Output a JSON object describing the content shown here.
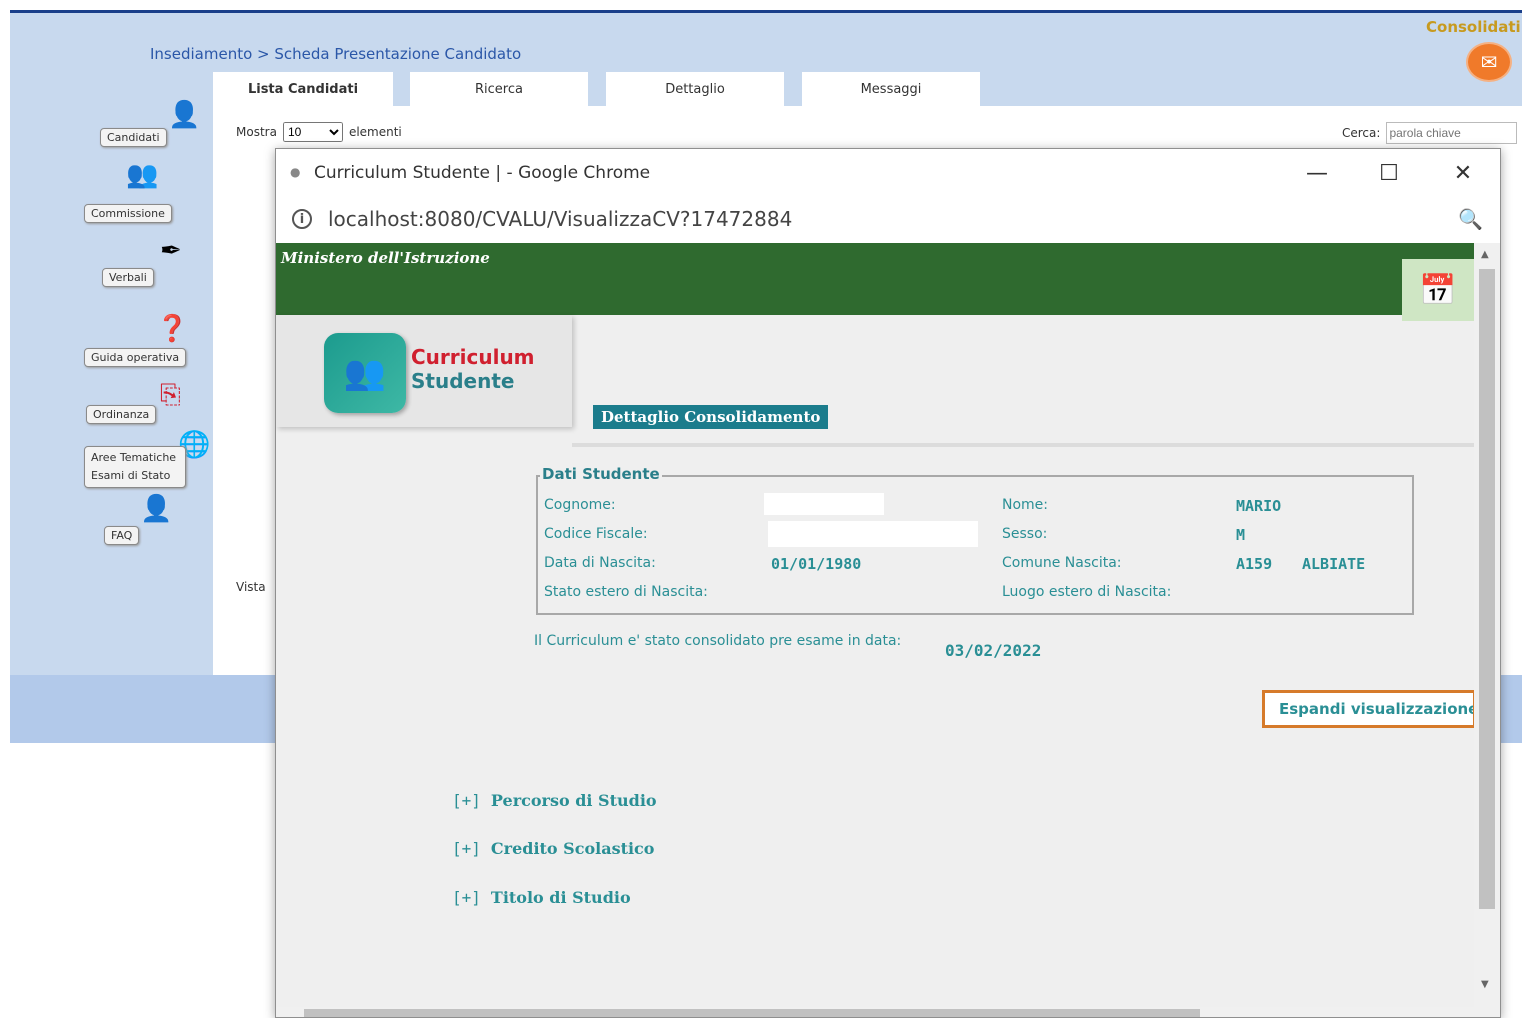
{
  "background_app": {
    "breadcrumb": "Insediamento > Scheda Presentazione Candidato",
    "consolidati_label": "Consolidati",
    "tabs": [
      {
        "label": "Lista Candidati"
      },
      {
        "label": "Ricerca"
      },
      {
        "label": "Dettaglio"
      },
      {
        "label": "Messaggi"
      }
    ],
    "mostra_prefix": "Mostra",
    "mostra_value": "10",
    "mostra_suffix": "elementi",
    "cerca_label": "Cerca:",
    "cerca_placeholder": "parola chiave",
    "vista_label": "Vista",
    "sidebar": [
      {
        "label": "Candidati",
        "icon": "candidates-icon"
      },
      {
        "label": "Commissione",
        "icon": "commission-icon"
      },
      {
        "label": "Verbali",
        "icon": "quill-icon"
      },
      {
        "label": "Guida operativa",
        "icon": "help-icon"
      },
      {
        "label": "Ordinanza",
        "icon": "pdf-icon"
      },
      {
        "label": "Aree Tematiche Esami di Stato",
        "icon": "globe-icon"
      },
      {
        "label": "FAQ",
        "icon": "faq-icon"
      }
    ]
  },
  "popup": {
    "window_title": "Curriculum Studente | - Google Chrome",
    "url": "localhost:8080/CVALU/VisualizzaCV?17472884",
    "header_title": "Ministero dell'Istruzione",
    "logo_line1": "Curriculum",
    "logo_line2": "Studente",
    "badge": "Dettaglio Consolidamento",
    "dati_studente": {
      "legend": "Dati Studente",
      "cognome_label": "Cognome:",
      "nome_label": "Nome:",
      "nome_value": "MARIO",
      "codice_fiscale_label": "Codice Fiscale:",
      "sesso_label": "Sesso:",
      "sesso_value": "M",
      "data_nascita_label": "Data di Nascita:",
      "data_nascita_value": "01/01/1980",
      "comune_nascita_label": "Comune Nascita:",
      "comune_code": "A159",
      "comune_name": "ALBIATE",
      "stato_estero_label": "Stato estero di Nascita:",
      "luogo_estero_label": "Luogo estero di Nascita:"
    },
    "consolidato_text": "Il Curriculum e' stato consolidato pre esame in data:",
    "consolidato_date": "03/02/2022",
    "espandi_button": "Espandi visualizzazione",
    "sections": [
      {
        "toggle": "[+]",
        "label": "Percorso di Studio"
      },
      {
        "toggle": "[+]",
        "label": "Credito Scolastico"
      },
      {
        "toggle": "[+]",
        "label": "Titolo di Studio"
      }
    ]
  },
  "colors": {
    "header_green": "#2f6a2f",
    "teal_text": "#2a8f95",
    "badge_teal": "#1b7c8c",
    "button_border": "#d67a2a"
  }
}
